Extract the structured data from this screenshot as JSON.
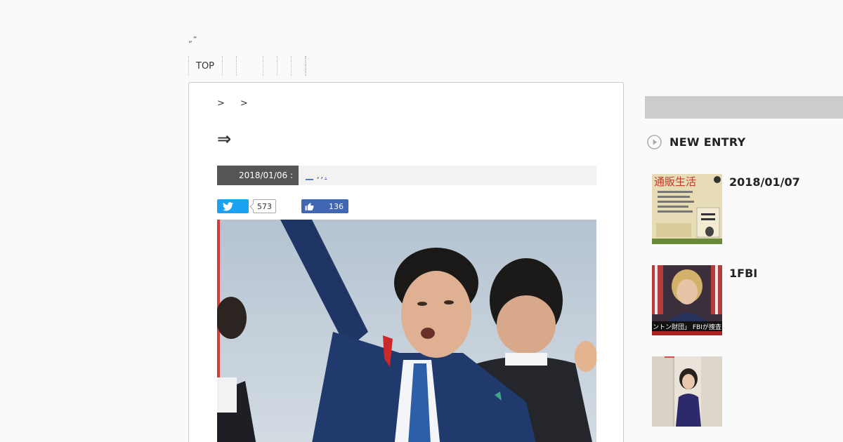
{
  "header": {
    "site_title": "„”"
  },
  "nav": {
    "items": [
      {
        "label": "TOP"
      },
      {
        "label": ""
      },
      {
        "label": ""
      },
      {
        "label": ""
      },
      {
        "label": ""
      },
      {
        "label": ""
      },
      {
        "label": ""
      }
    ]
  },
  "article": {
    "breadcrumb": [
      ">",
      ">"
    ],
    "title": "⇒",
    "date": "2018/01/06 :",
    "tags": [
      "__",
      ",",
      ",",
      "."
    ]
  },
  "share": {
    "twitter_count": "573",
    "facebook_count": "136"
  },
  "sidebar": {
    "section_heading": "NEW ENTRY",
    "entries": [
      {
        "title": "2018/01/07",
        "thumb_text": "通販生活"
      },
      {
        "title": "1FBI",
        "thumb_text": "ントン財団」 FBIが捜査"
      },
      {
        "title": ""
      }
    ]
  },
  "colors": {
    "twitter": "#1da1f2",
    "facebook": "#4267b2",
    "meta_date_bg": "#555555",
    "sidebar_strip": "#cccccc"
  }
}
